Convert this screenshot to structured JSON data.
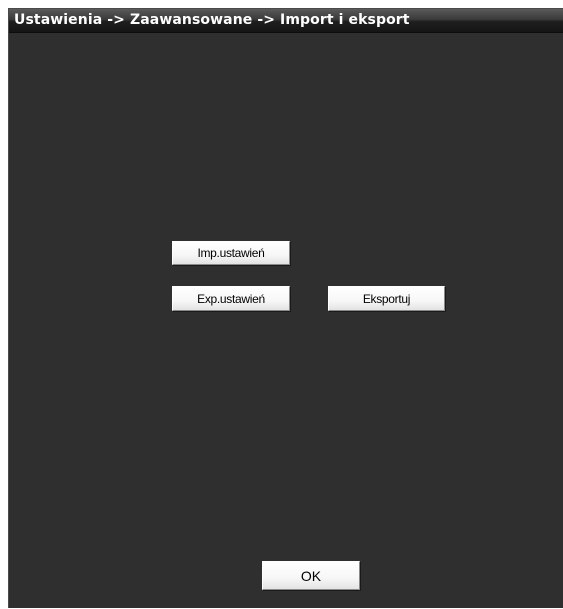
{
  "window": {
    "title": "Ustawienia -> Zaawansowane -> Import i eksport"
  },
  "buttons": {
    "import_settings": "Imp.ustawień",
    "export_settings": "Exp.ustawień",
    "export": "Eksportuj",
    "ok": "OK"
  },
  "colors": {
    "background": "#2f2f2f",
    "title_text": "#ffffff",
    "button_face": "#f4f4f4"
  }
}
